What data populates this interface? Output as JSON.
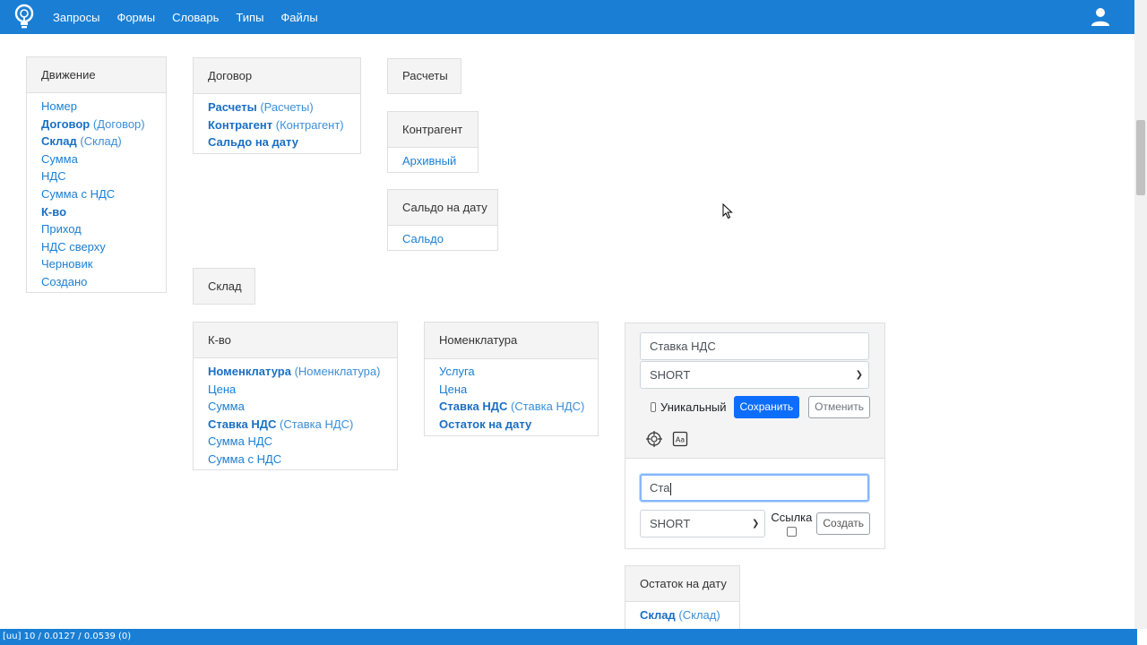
{
  "nav": {
    "items": [
      {
        "label": "Запросы"
      },
      {
        "label": "Формы"
      },
      {
        "label": "Словарь"
      },
      {
        "label": "Типы"
      },
      {
        "label": "Файлы"
      }
    ]
  },
  "cards": {
    "dvizhenie": {
      "title": "Движение",
      "items": [
        {
          "label": "Номер",
          "ref": ""
        },
        {
          "label": "Договор",
          "ref": "(Договор)"
        },
        {
          "label": "Склад",
          "ref": "(Склад)"
        },
        {
          "label": "Сумма",
          "ref": ""
        },
        {
          "label": "НДС",
          "ref": ""
        },
        {
          "label": "Сумма с НДС",
          "ref": ""
        },
        {
          "label": "К-во",
          "ref": ""
        },
        {
          "label": "Приход",
          "ref": ""
        },
        {
          "label": "НДС сверху",
          "ref": ""
        },
        {
          "label": "Черновик",
          "ref": ""
        },
        {
          "label": "Создано",
          "ref": ""
        }
      ]
    },
    "dogovor": {
      "title": "Договор",
      "items": [
        {
          "label": "Расчеты",
          "ref": "(Расчеты)"
        },
        {
          "label": "Контрагент",
          "ref": "(Контрагент)"
        },
        {
          "label": "Сальдо на дату",
          "ref": ""
        }
      ]
    },
    "raschety": {
      "title": "Расчеты"
    },
    "kontragent": {
      "title": "Контрагент",
      "items": [
        {
          "label": "Архивный"
        }
      ]
    },
    "saldo": {
      "title": "Сальдо на дату",
      "items": [
        {
          "label": "Сальдо"
        }
      ]
    },
    "sklad": {
      "title": "Склад"
    },
    "kvo": {
      "title": "К-во",
      "items": [
        {
          "label": "Номенклатура",
          "ref": "(Номенклатура)"
        },
        {
          "label": "Цена",
          "ref": ""
        },
        {
          "label": "Сумма",
          "ref": ""
        },
        {
          "label": "Ставка НДС",
          "ref": "(Ставка НДС)"
        },
        {
          "label": "Сумма НДС",
          "ref": ""
        },
        {
          "label": "Сумма с НДС",
          "ref": ""
        }
      ]
    },
    "nomenklatura": {
      "title": "Номенклатура",
      "items": [
        {
          "label": "Услуга",
          "ref": ""
        },
        {
          "label": "Цена",
          "ref": ""
        },
        {
          "label": "Ставка НДС",
          "ref": "(Ставка НДС)"
        },
        {
          "label": "Остаток на дату",
          "ref": ""
        }
      ]
    },
    "ostatok": {
      "title": "Остаток на дату",
      "items": [
        {
          "label": "Склад",
          "ref": "(Склад)"
        }
      ]
    }
  },
  "edit_panel": {
    "name_value": "Ставка НДС",
    "type_value": "SHORT",
    "unique_label": "Уникальный",
    "unique_checked": false,
    "save_label": "Сохранить",
    "cancel_label": "Отменить",
    "new_name_value": "Ста",
    "new_type_value": "SHORT",
    "link_label": "Ссылка",
    "link_checked": false,
    "create_label": "Создать"
  },
  "status": {
    "text": "[uu] 10 / 0.0127 / 0.0539 (0)"
  },
  "colors": {
    "navbar": "#1a7fd4",
    "link": "#1a7fd4",
    "primary": "#0d6efd"
  }
}
